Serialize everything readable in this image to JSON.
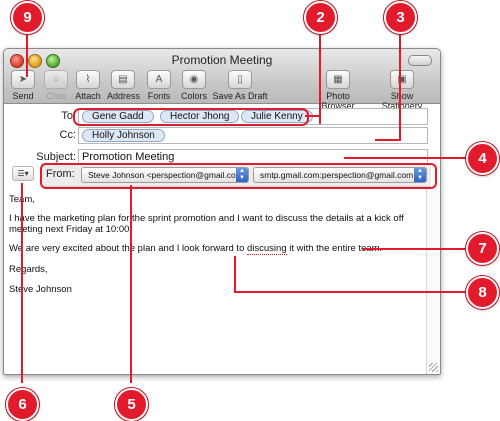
{
  "window": {
    "title": "Promotion Meeting"
  },
  "toolbar": {
    "send": "Send",
    "chat": "Chat",
    "attach": "Attach",
    "address": "Address",
    "fonts": "Fonts",
    "colors": "Colors",
    "save_draft": "Save As Draft",
    "photo_browser": "Photo Browser",
    "show_stationery": "Show Stationery"
  },
  "header": {
    "to_label": "To:",
    "to": [
      "Gene Gadd",
      "Hector Jhong",
      "Julie Kenny"
    ],
    "cc_label": "Cc:",
    "cc": [
      "Holly Johnson"
    ],
    "subject_label": "Subject:",
    "subject": "Promotion Meeting",
    "from_label": "From:",
    "from_account": "Steve Johnson <perspection@gmail.com>",
    "smtp": "smtp.gmail.com:perspection@gmail.com"
  },
  "body": {
    "greeting": "Team,",
    "para1": "I have the marketing plan for the sprint promotion and I want to discuss the details at a kick off meeting next Friday at 10:00.",
    "para2_before": "We are very excited about the plan and I look forward to ",
    "para2_misspelled": "discusing",
    "para2_after": " it with the entire team.",
    "closing": "Regards,",
    "signature": "Steve Johnson"
  },
  "callouts": [
    "9",
    "2",
    "3",
    "4",
    "7",
    "8",
    "6",
    "5"
  ],
  "colors": {
    "callout": "#e11b2b",
    "token_bg": "#dde7f6",
    "select_arrow": "#2d63c2"
  }
}
